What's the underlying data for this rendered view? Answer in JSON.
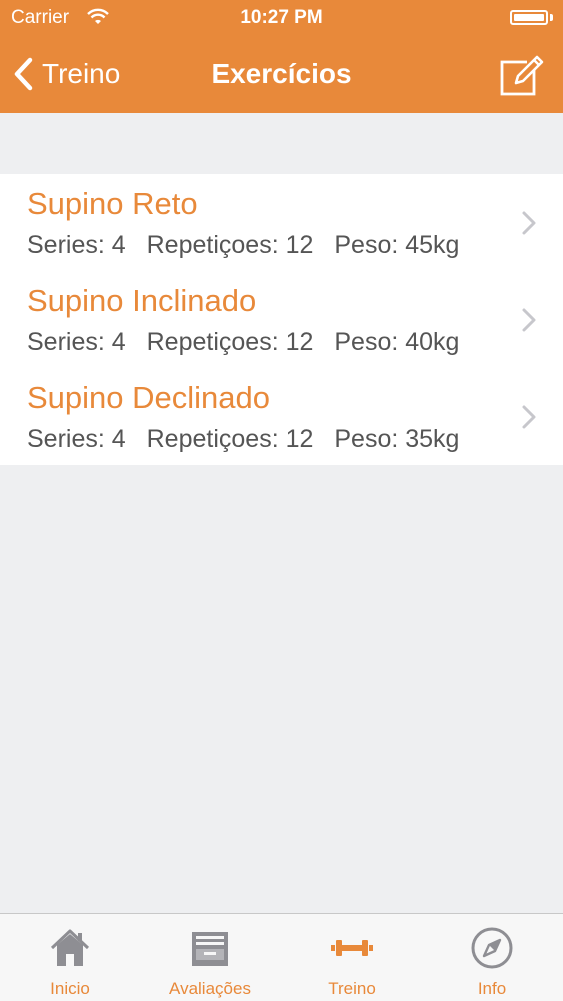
{
  "status_bar": {
    "carrier": "Carrier",
    "time": "10:27 PM"
  },
  "nav": {
    "back_label": "Treino",
    "title": "Exercícios",
    "edit_icon": "compose-icon"
  },
  "exercises": [
    {
      "name": "Supino Reto",
      "series": "Series: 4",
      "reps": "Repetiçoes: 12",
      "weight": "Peso: 45kg"
    },
    {
      "name": "Supino Inclinado",
      "series": "Series: 4",
      "reps": "Repetiçoes: 12",
      "weight": "Peso: 40kg"
    },
    {
      "name": "Supino Declinado",
      "series": "Series: 4",
      "reps": "Repetiçoes: 12",
      "weight": "Peso: 35kg"
    }
  ],
  "tabbar": {
    "tabs": [
      {
        "label": "Inicio",
        "icon": "home-icon"
      },
      {
        "label": "Avaliações",
        "icon": "inbox-tray-icon"
      },
      {
        "label": "Treino",
        "icon": "dumbbell-icon",
        "selected": true
      },
      {
        "label": "Info",
        "icon": "compass-icon"
      }
    ]
  },
  "colors": {
    "accent": "#e8893a",
    "background": "#eeeff1",
    "inactive_icon": "#8e8e93"
  }
}
